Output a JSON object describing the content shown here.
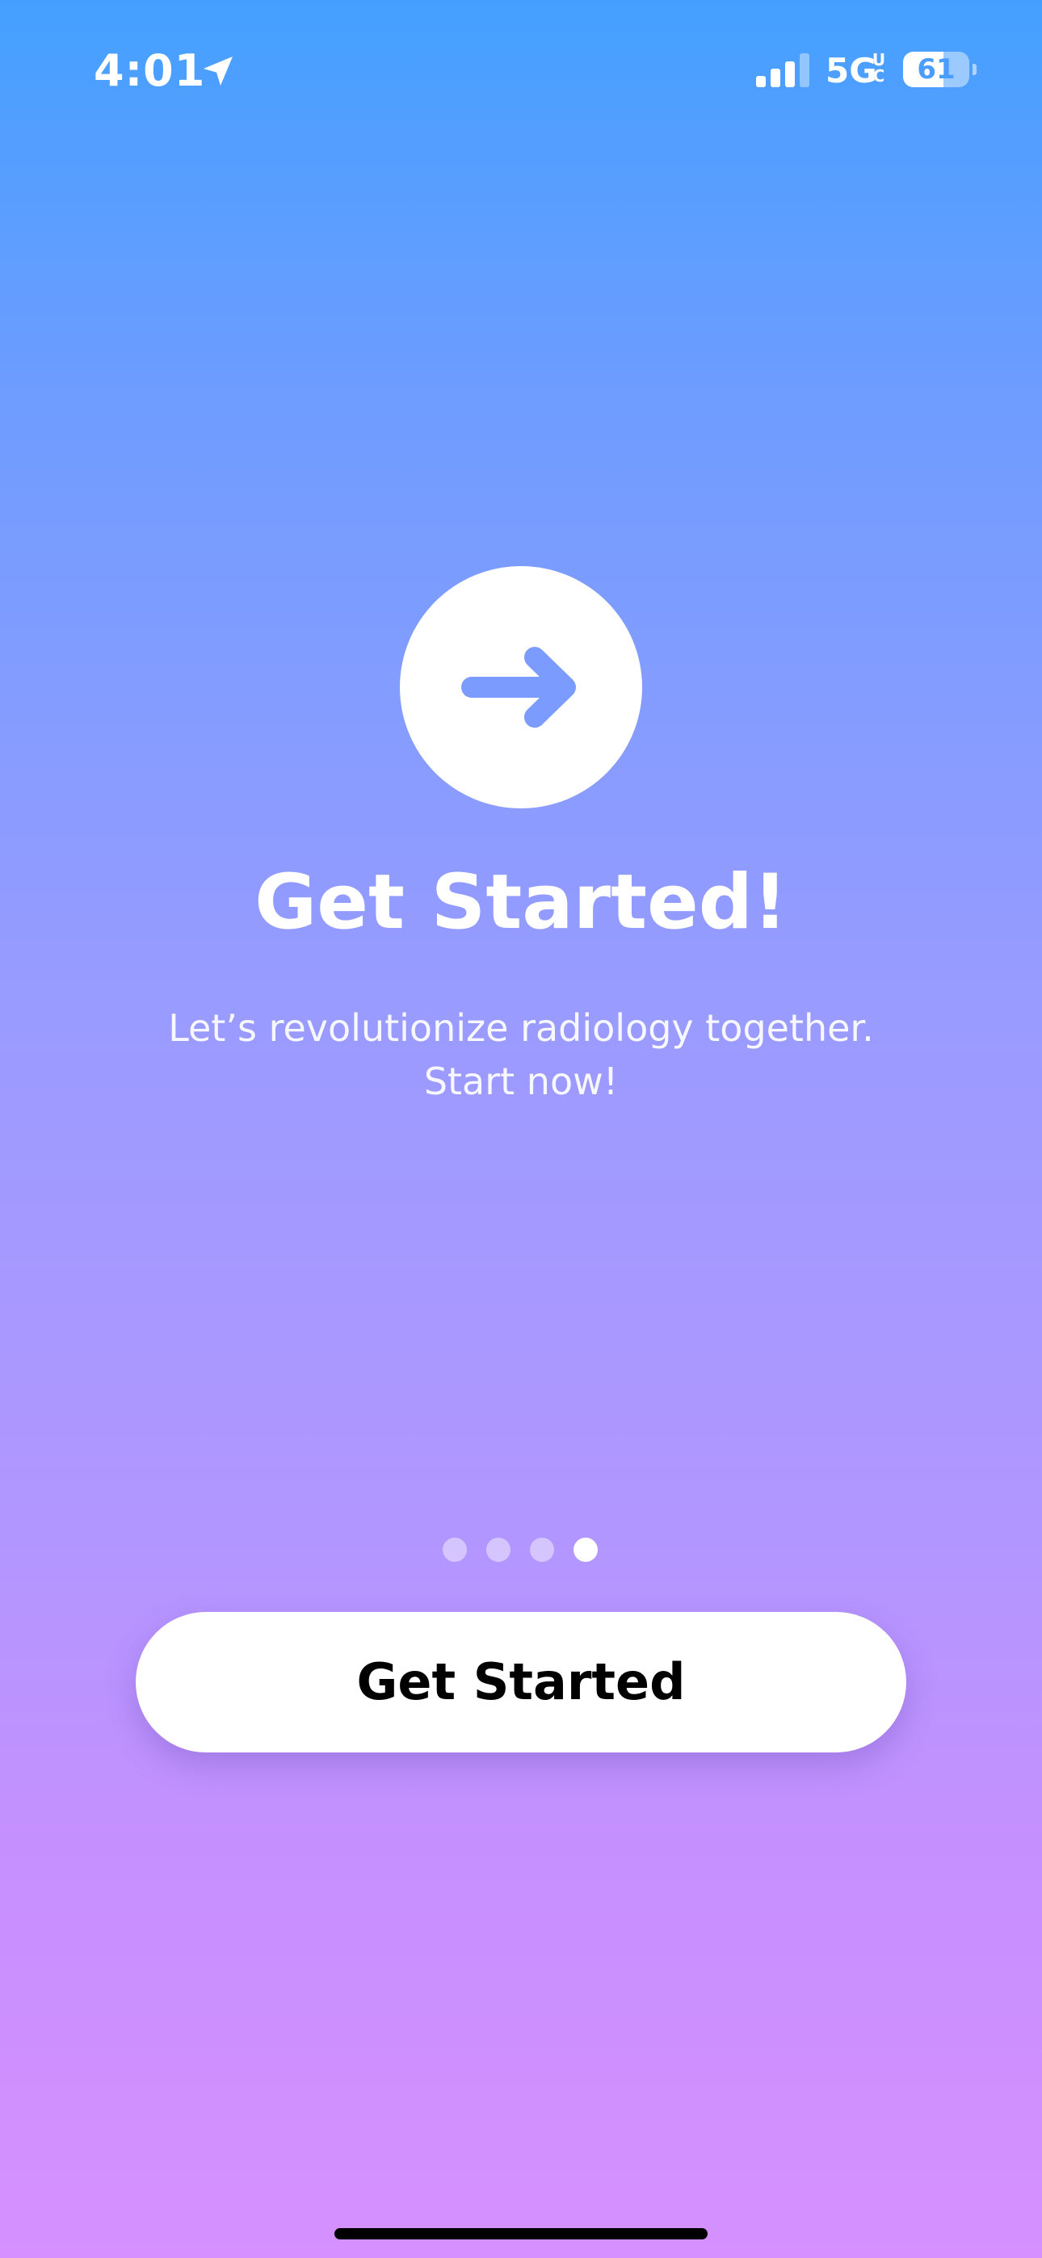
{
  "status_bar": {
    "time": "4:01",
    "network": "5G",
    "network_sub": "UC",
    "battery_level": 61,
    "battery_label": "61",
    "location_icon": "location-arrow-icon",
    "signal_icon": "cellular-signal-icon",
    "signal_bars_active": 3
  },
  "hero": {
    "icon": "arrow-right-icon",
    "title": "Get Started!",
    "subtitle_line1": "Let’s revolutionize radiology together.",
    "subtitle_line2": "Start now!"
  },
  "pager": {
    "total_pages": 4,
    "current_page": 4
  },
  "cta": {
    "label": "Get Started"
  },
  "colors": {
    "gradient_top": "#44a0ff",
    "gradient_bottom": "#d690ff",
    "arrow": "#7c9bff",
    "button_bg": "#ffffff",
    "button_text": "#000000"
  }
}
